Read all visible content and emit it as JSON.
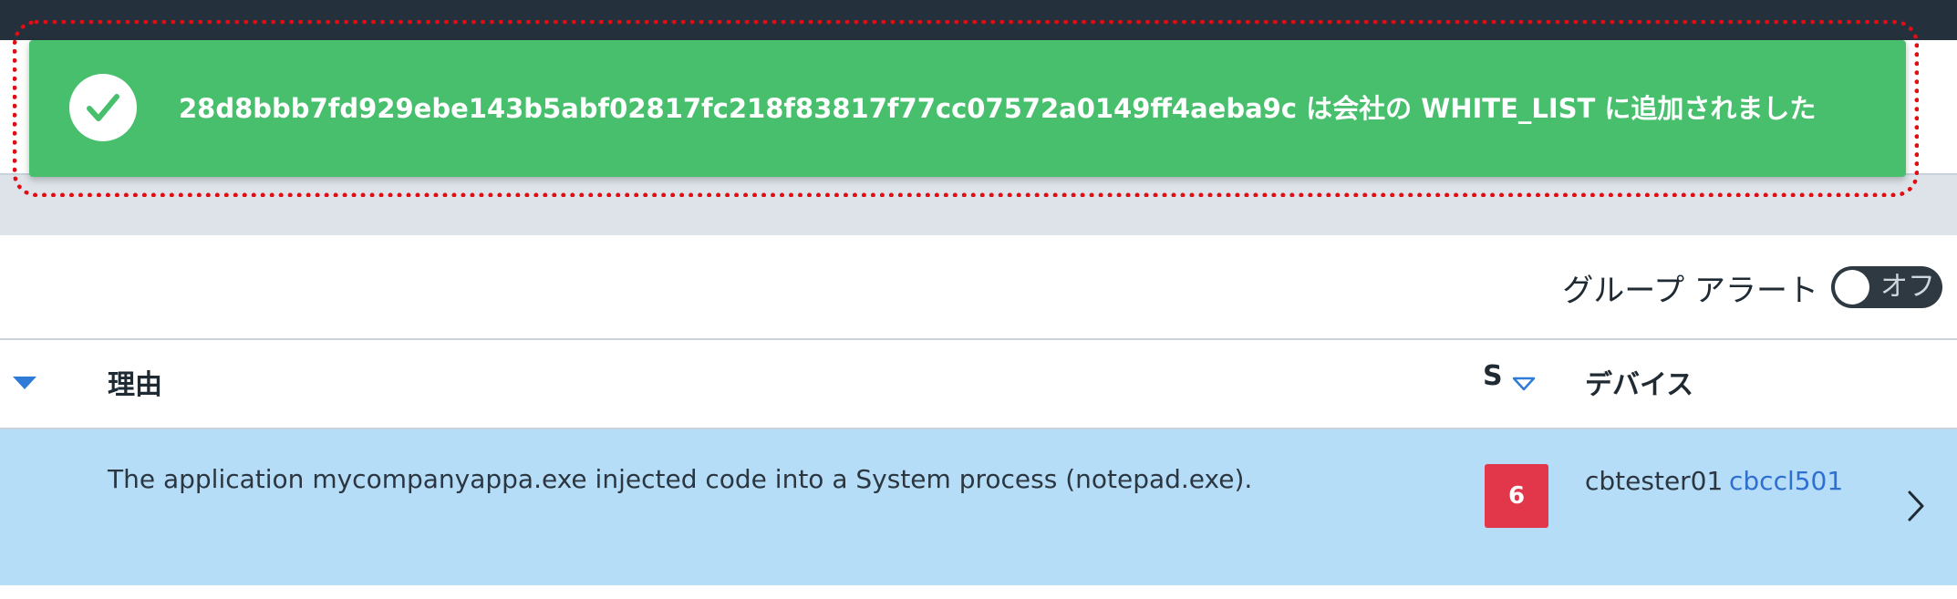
{
  "toast": {
    "message": "28d8bbb7fd929ebe143b5abf02817fc218f83817f77cc07572a0149ff4aeba9c は会社の WHITE_LIST に追加されました",
    "icon": "checkmark-icon",
    "color": "#48bf6d"
  },
  "group_alert": {
    "label": "グループ アラート",
    "toggle_state": "オフ"
  },
  "table": {
    "columns": {
      "reason": "理由",
      "severity": "S",
      "device": "デバイス"
    },
    "rows": [
      {
        "reason": "The application mycompanyappa.exe injected code into a System process (notepad.exe).",
        "severity": "6",
        "device_name": "cbtester01",
        "device_group": "cbccl501"
      }
    ]
  },
  "colors": {
    "topbar": "#24303b",
    "selected_row": "#b6ddf7",
    "severity_badge": "#e2364b",
    "link": "#2f6fd1",
    "highlight_outline": "#e00d14"
  }
}
